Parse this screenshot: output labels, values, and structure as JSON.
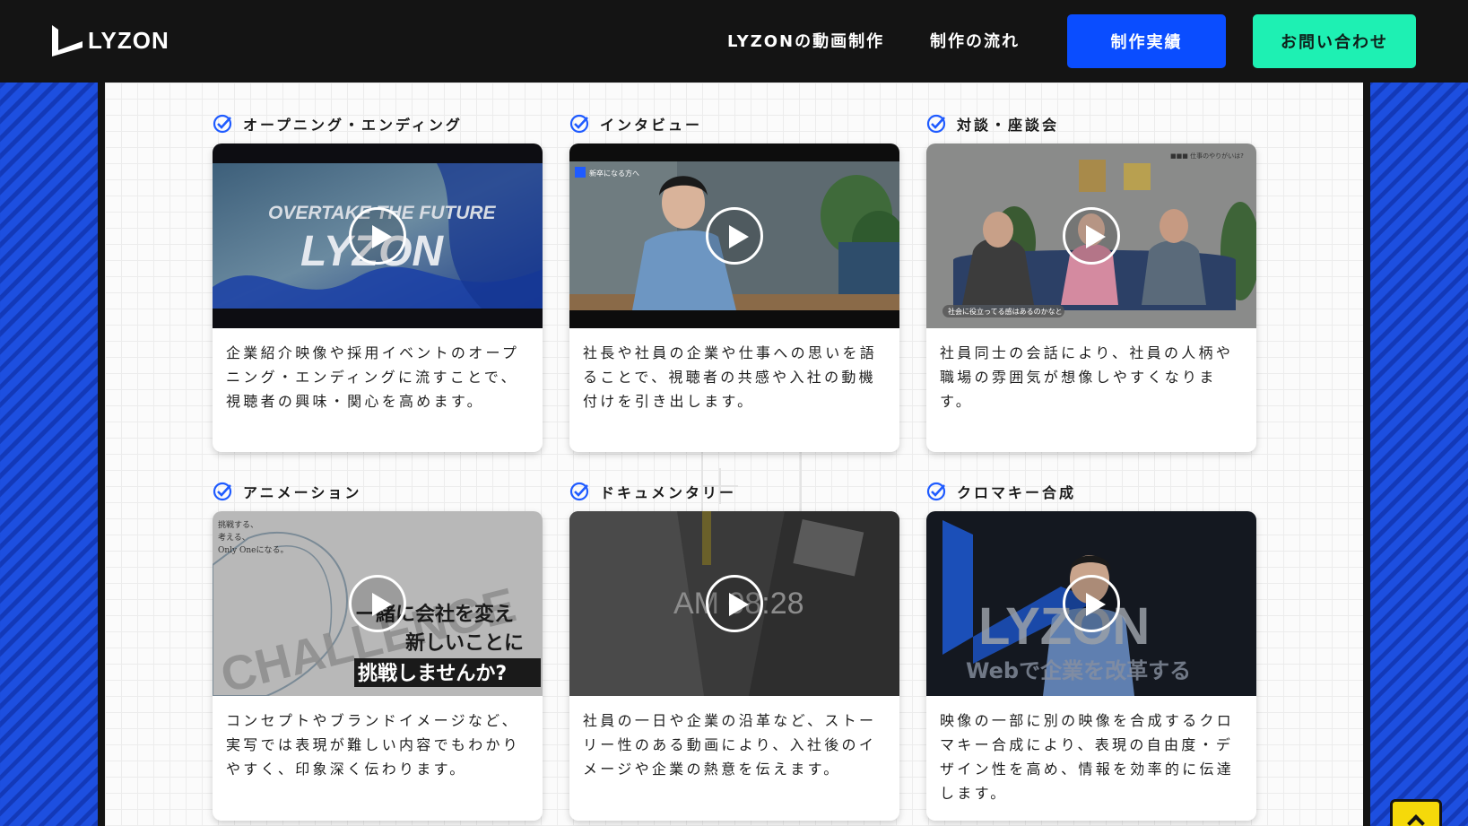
{
  "header": {
    "logo_text": "LYZON",
    "nav": {
      "video_production": "LYZONの動画制作",
      "flow": "制作の流れ",
      "works": "制作実績",
      "contact": "お問い合わせ"
    }
  },
  "cards": [
    {
      "title": "オープニング・エンディング",
      "description": "企業紹介映像や採用イベントのオープニング・エンディングに流すことで、視聴者の興味・関心を高めます。",
      "thumb_text": [
        "OVERTAKE THE FUTURE",
        "LYZON"
      ]
    },
    {
      "title": "インタビュー",
      "description": "社長や社員の企業や仕事への思いを語ることで、視聴者の共感や入社の動機付けを引き出します。",
      "thumb_text": [
        "新卒になる方へ"
      ]
    },
    {
      "title": "対談・座談会",
      "description": "社員同士の会話により、社員の人柄や職場の雰囲気が想像しやすくなります。",
      "thumb_text": [
        "■■■ 仕事のやりがいは?",
        "社会に役立ってる感はあるのかなと"
      ]
    },
    {
      "title": "アニメーション",
      "description": "コンセプトやブランドイメージなど、実写では表現が難しい内容でもわかりやすく、印象深く伝わります。",
      "thumb_text": [
        "挑戦する、",
        "考える、",
        "Only Oneになる。",
        "CHALLENGE",
        "一緒に会社を変え",
        "新しいことに",
        "挑戦しませんか?"
      ]
    },
    {
      "title": "ドキュメンタリー",
      "description": "社員の一日や企業の沿革など、ストーリー性のある動画により、入社後のイメージや企業の熱意を伝えます。",
      "thumb_text": [
        "AM 08:28"
      ]
    },
    {
      "title": "クロマキー合成",
      "description": "映像の一部に別の映像を合成するクロマキー合成により、表現の自由度・デザイン性を高め、情報を効率的に伝達します。",
      "thumb_text": [
        "LYZON",
        "Webで企業を改革する"
      ]
    }
  ],
  "colors": {
    "header_bg": "#141414",
    "works_button": "#0a4dff",
    "contact_button": "#1ef0b3",
    "check_accent": "#1f5bff",
    "scroll_top": "#f5d90a"
  }
}
